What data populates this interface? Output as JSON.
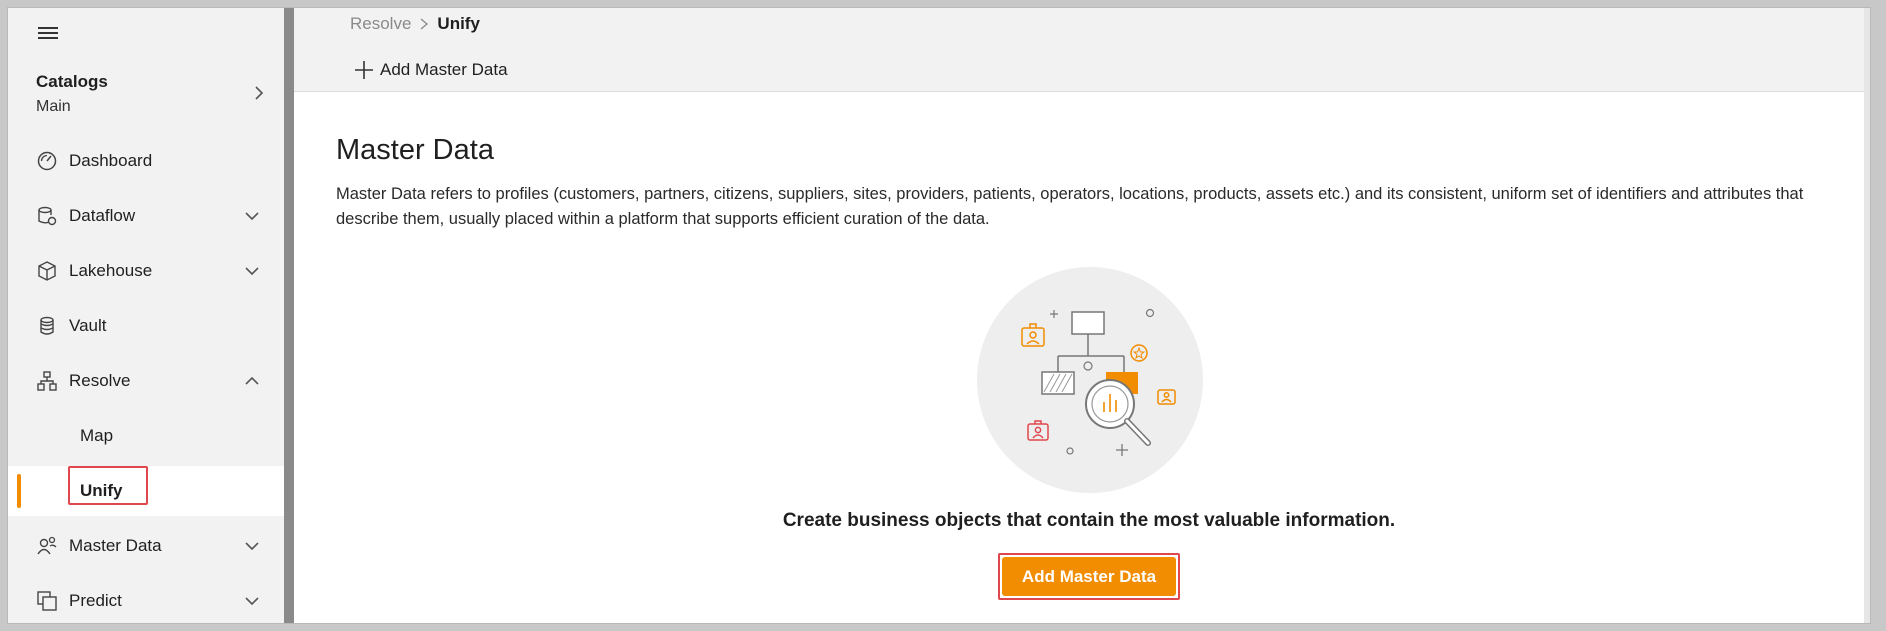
{
  "sidebar": {
    "catalog": {
      "title": "Catalogs",
      "subtitle": "Main"
    },
    "items": [
      {
        "label": "Dashboard",
        "icon": "dashboard-icon"
      },
      {
        "label": "Dataflow",
        "icon": "dataflow-icon",
        "expandable": true
      },
      {
        "label": "Lakehouse",
        "icon": "lakehouse-icon",
        "expandable": true
      },
      {
        "label": "Vault",
        "icon": "vault-icon"
      },
      {
        "label": "Resolve",
        "icon": "resolve-icon",
        "expanded": true
      },
      {
        "label": "Map"
      },
      {
        "label": "Unify",
        "active": true
      },
      {
        "label": "Master Data",
        "icon": "master-data-icon",
        "expandable": true
      },
      {
        "label": "Predict",
        "icon": "predict-icon",
        "expandable": true
      }
    ]
  },
  "header": {
    "breadcrumb": [
      "Resolve",
      "Unify"
    ],
    "add_label": "Add Master Data"
  },
  "main": {
    "title": "Master Data",
    "description": "Master Data refers to profiles (customers, partners, citizens, suppliers, sites, providers, patients, operators, locations, products, assets etc.) and its consistent, uniform set of identifiers and attributes that describe them, usually placed within a platform that supports efficient curation of the data.",
    "cta_text": "Create business objects that contain the most valuable information.",
    "cta_button": "Add Master Data"
  },
  "colors": {
    "accent": "#f28c00",
    "highlight": "#e0474c",
    "sidebar_bg": "#f2f2f2"
  }
}
